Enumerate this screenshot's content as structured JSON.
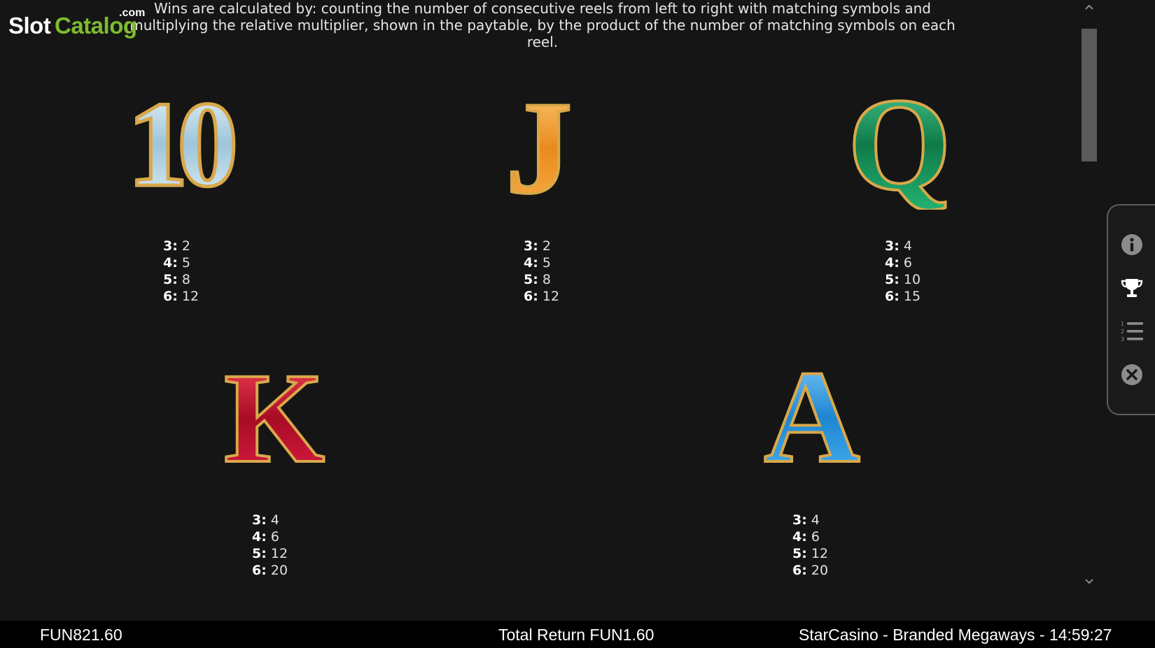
{
  "logo": {
    "part1": "Slot",
    "part2": "Catalog",
    "suffix": ".com"
  },
  "description": "Wins are calculated by: counting the number of consecutive reels from left to right with matching symbols and multiplying the relative multiplier, shown in the paytable, by the product of the number of matching symbols on each reel.",
  "symbols": [
    {
      "icon": "ten-symbol-icon",
      "glyph": "10",
      "payouts": [
        {
          "k": "3:",
          "v": "2"
        },
        {
          "k": "4:",
          "v": "5"
        },
        {
          "k": "5:",
          "v": "8"
        },
        {
          "k": "6:",
          "v": "12"
        }
      ]
    },
    {
      "icon": "jack-symbol-icon",
      "glyph": "J",
      "payouts": [
        {
          "k": "3:",
          "v": "2"
        },
        {
          "k": "4:",
          "v": "5"
        },
        {
          "k": "5:",
          "v": "8"
        },
        {
          "k": "6:",
          "v": "12"
        }
      ]
    },
    {
      "icon": "queen-symbol-icon",
      "glyph": "Q",
      "payouts": [
        {
          "k": "3:",
          "v": "4"
        },
        {
          "k": "4:",
          "v": "6"
        },
        {
          "k": "5:",
          "v": "10"
        },
        {
          "k": "6:",
          "v": "15"
        }
      ]
    },
    {
      "icon": "king-symbol-icon",
      "glyph": "K",
      "payouts": [
        {
          "k": "3:",
          "v": "4"
        },
        {
          "k": "4:",
          "v": "6"
        },
        {
          "k": "5:",
          "v": "12"
        },
        {
          "k": "6:",
          "v": "20"
        }
      ]
    },
    {
      "icon": "ace-symbol-icon",
      "glyph": "A",
      "payouts": [
        {
          "k": "3:",
          "v": "4"
        },
        {
          "k": "4:",
          "v": "6"
        },
        {
          "k": "5:",
          "v": "12"
        },
        {
          "k": "6:",
          "v": "20"
        }
      ]
    }
  ],
  "side_menu": {
    "items": [
      "info-icon",
      "trophy-icon",
      "numbered-list-icon",
      "close-icon"
    ]
  },
  "scroll": {
    "up": "^",
    "down": "v"
  },
  "bottom_bar": {
    "balance": "FUN821.60",
    "total_return": "Total Return FUN1.60",
    "title_time": "StarCasino - Branded Megaways - 14:59:27"
  },
  "colors": {
    "background": "#151515",
    "bar": "#000000",
    "logo_green": "#7dbb2e",
    "gold": "#d9a84a",
    "ten_fill": "#cfe3ee",
    "jack_fill": "#f2a23a",
    "queen_fill": "#1b9a5e",
    "king_fill": "#c8102e",
    "ace_fill": "#2f9fe0"
  }
}
